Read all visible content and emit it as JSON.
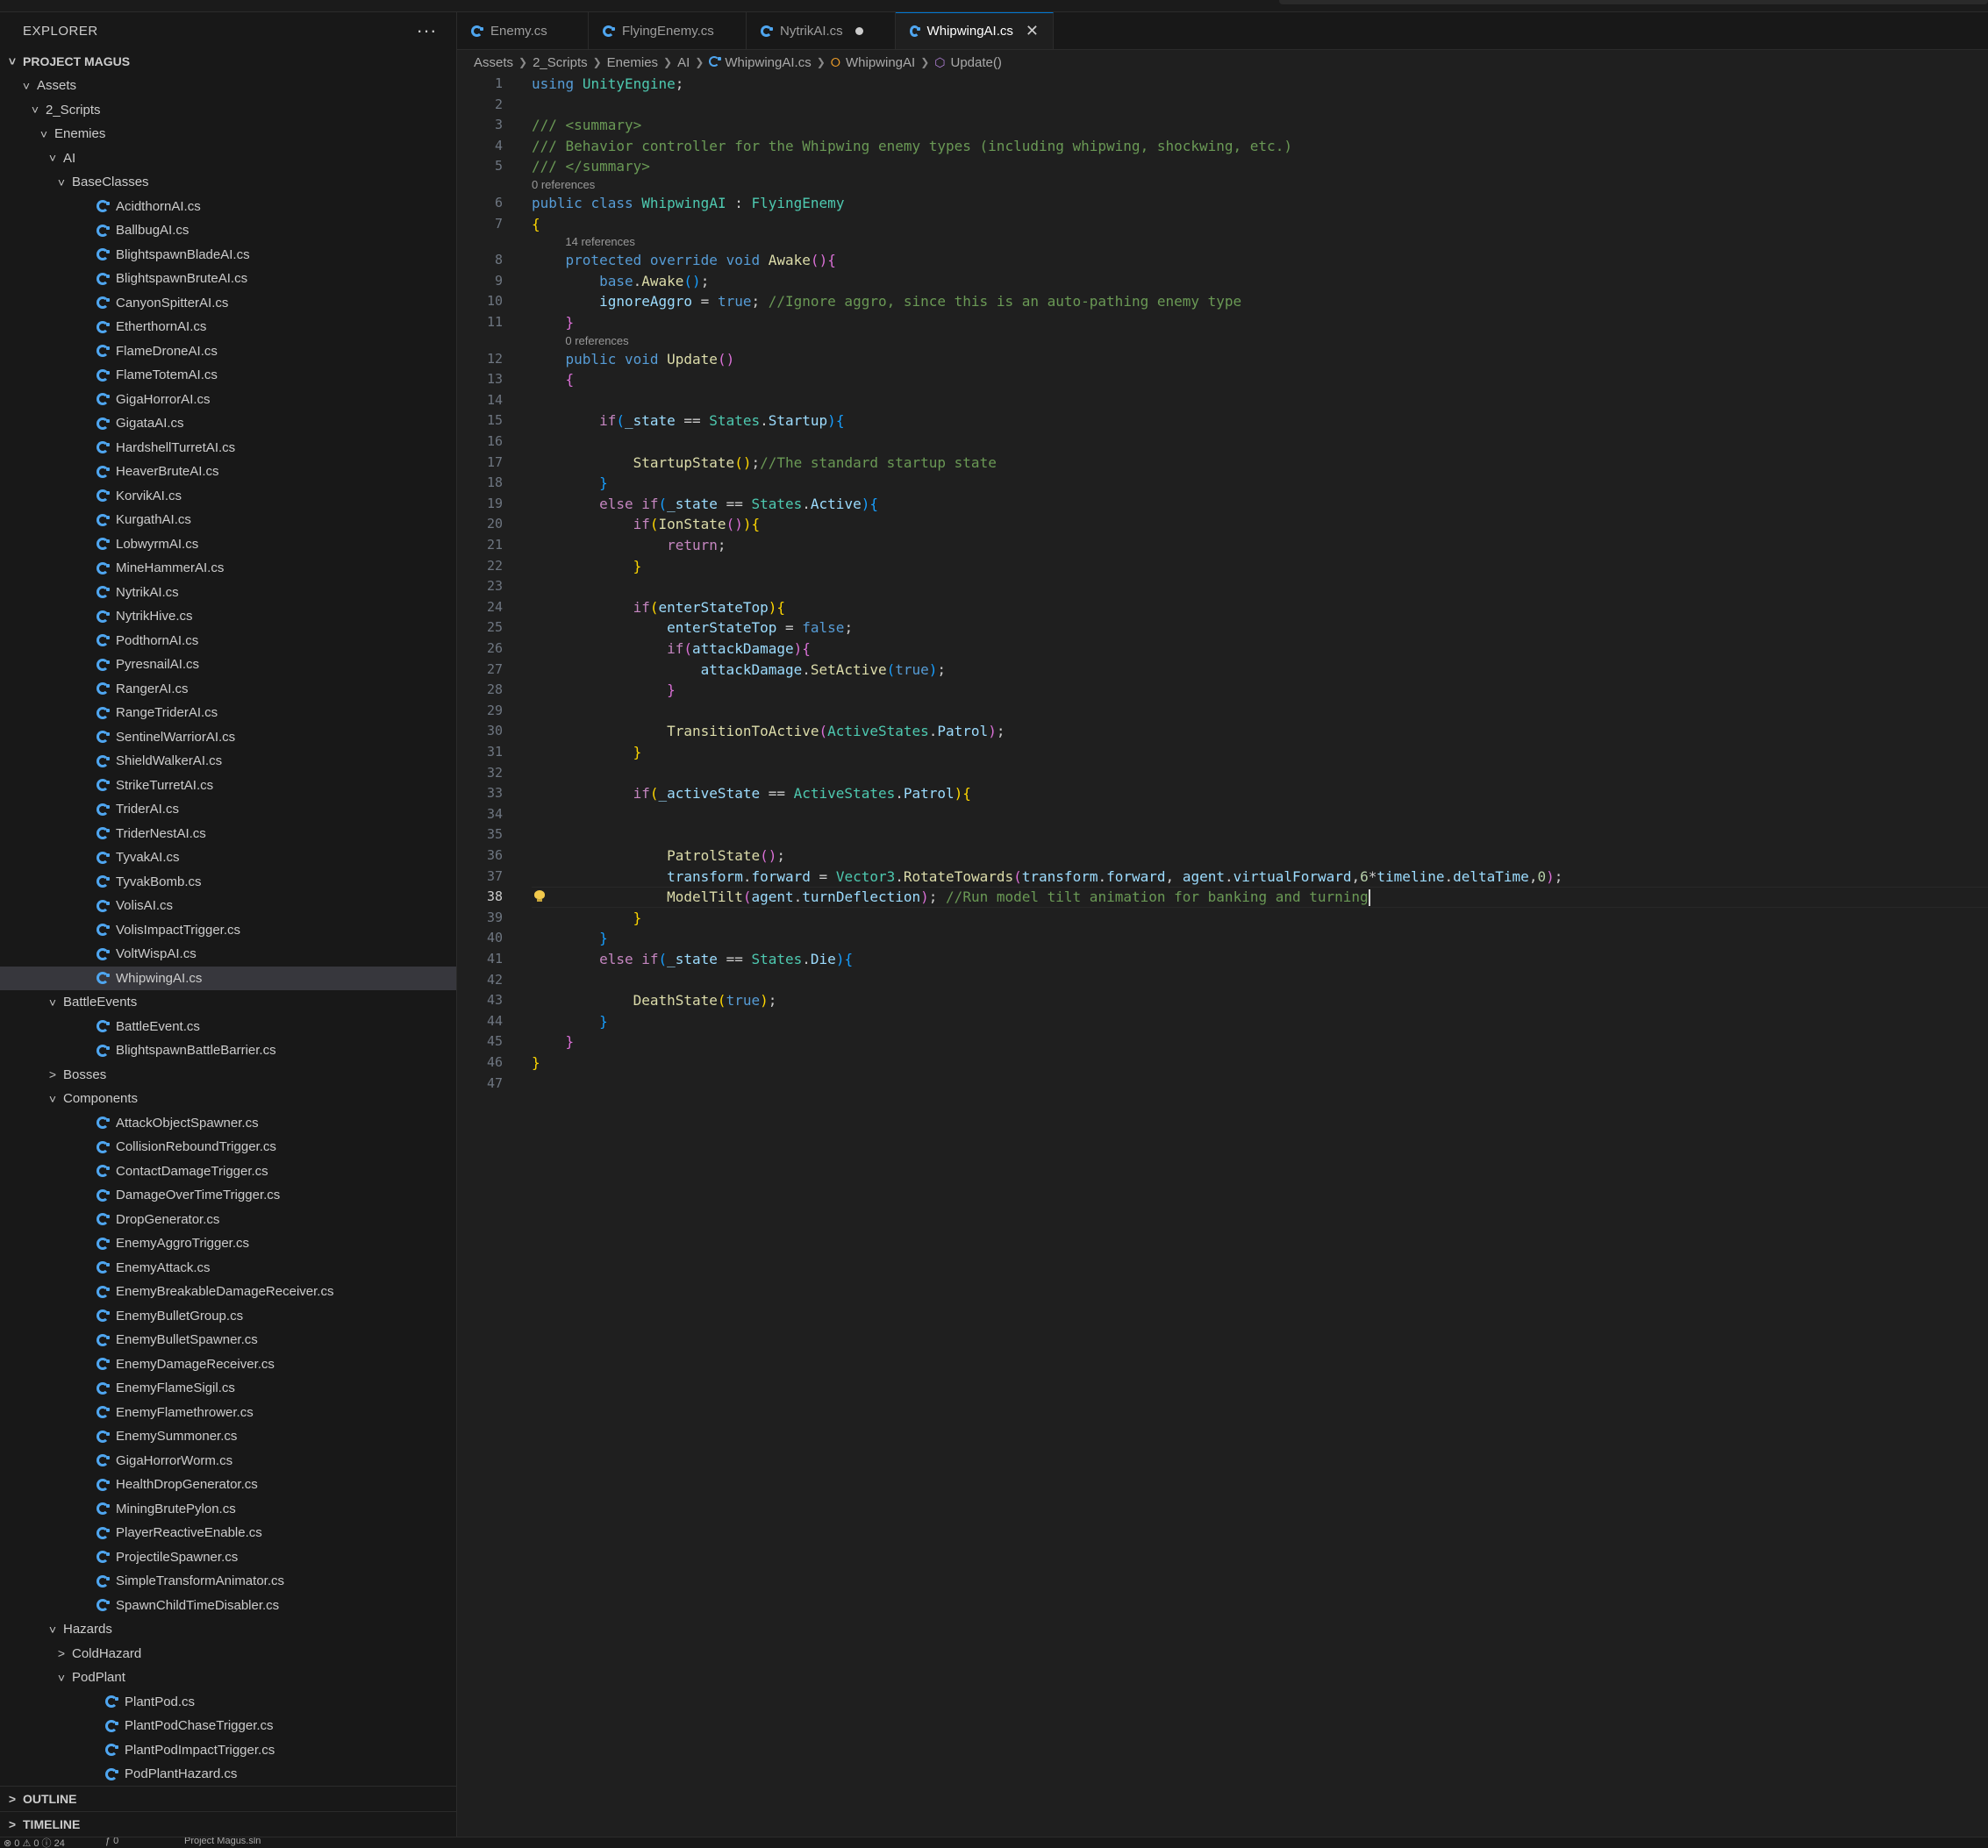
{
  "sidebar": {
    "title": "EXPLORER",
    "more": "···",
    "project": "PROJECT MAGUS",
    "tree": [
      {
        "label": "Assets",
        "depth": 1,
        "type": "folder",
        "open": true
      },
      {
        "label": "2_Scripts",
        "depth": 2,
        "type": "folder",
        "open": true
      },
      {
        "label": "Enemies",
        "depth": 3,
        "type": "folder",
        "open": true
      },
      {
        "label": "AI",
        "depth": 4,
        "type": "folder",
        "open": true
      },
      {
        "label": "BaseClasses",
        "depth": 5,
        "type": "folder",
        "open": true
      },
      {
        "label": "AcidthornAI.cs",
        "depth": 5,
        "type": "file"
      },
      {
        "label": "BallbugAI.cs",
        "depth": 5,
        "type": "file"
      },
      {
        "label": "BlightspawnBladeAI.cs",
        "depth": 5,
        "type": "file"
      },
      {
        "label": "BlightspawnBruteAI.cs",
        "depth": 5,
        "type": "file"
      },
      {
        "label": "CanyonSpitterAI.cs",
        "depth": 5,
        "type": "file"
      },
      {
        "label": "EtherthornAI.cs",
        "depth": 5,
        "type": "file"
      },
      {
        "label": "FlameDroneAI.cs",
        "depth": 5,
        "type": "file"
      },
      {
        "label": "FlameTotemAI.cs",
        "depth": 5,
        "type": "file"
      },
      {
        "label": "GigaHorrorAI.cs",
        "depth": 5,
        "type": "file"
      },
      {
        "label": "GigataAI.cs",
        "depth": 5,
        "type": "file"
      },
      {
        "label": "HardshellTurretAI.cs",
        "depth": 5,
        "type": "file"
      },
      {
        "label": "HeaverBruteAI.cs",
        "depth": 5,
        "type": "file"
      },
      {
        "label": "KorvikAI.cs",
        "depth": 5,
        "type": "file"
      },
      {
        "label": "KurgathAI.cs",
        "depth": 5,
        "type": "file"
      },
      {
        "label": "LobwyrmAI.cs",
        "depth": 5,
        "type": "file"
      },
      {
        "label": "MineHammerAI.cs",
        "depth": 5,
        "type": "file"
      },
      {
        "label": "NytrikAI.cs",
        "depth": 5,
        "type": "file"
      },
      {
        "label": "NytrikHive.cs",
        "depth": 5,
        "type": "file"
      },
      {
        "label": "PodthornAI.cs",
        "depth": 5,
        "type": "file"
      },
      {
        "label": "PyresnailAI.cs",
        "depth": 5,
        "type": "file"
      },
      {
        "label": "RangerAI.cs",
        "depth": 5,
        "type": "file"
      },
      {
        "label": "RangeTriderAI.cs",
        "depth": 5,
        "type": "file"
      },
      {
        "label": "SentinelWarriorAI.cs",
        "depth": 5,
        "type": "file"
      },
      {
        "label": "ShieldWalkerAI.cs",
        "depth": 5,
        "type": "file"
      },
      {
        "label": "StrikeTurretAI.cs",
        "depth": 5,
        "type": "file"
      },
      {
        "label": "TriderAI.cs",
        "depth": 5,
        "type": "file"
      },
      {
        "label": "TriderNestAI.cs",
        "depth": 5,
        "type": "file"
      },
      {
        "label": "TyvakAI.cs",
        "depth": 5,
        "type": "file"
      },
      {
        "label": "TyvakBomb.cs",
        "depth": 5,
        "type": "file"
      },
      {
        "label": "VolisAI.cs",
        "depth": 5,
        "type": "file"
      },
      {
        "label": "VolisImpactTrigger.cs",
        "depth": 5,
        "type": "file"
      },
      {
        "label": "VoltWispAI.cs",
        "depth": 5,
        "type": "file"
      },
      {
        "label": "WhipwingAI.cs",
        "depth": 5,
        "type": "file",
        "selected": true
      },
      {
        "label": "BattleEvents",
        "depth": 4,
        "type": "folder",
        "open": true
      },
      {
        "label": "BattleEvent.cs",
        "depth": 5,
        "type": "file"
      },
      {
        "label": "BlightspawnBattleBarrier.cs",
        "depth": 5,
        "type": "file"
      },
      {
        "label": "Bosses",
        "depth": 4,
        "type": "folder",
        "open": false
      },
      {
        "label": "Components",
        "depth": 4,
        "type": "folder",
        "open": true
      },
      {
        "label": "AttackObjectSpawner.cs",
        "depth": 5,
        "type": "file"
      },
      {
        "label": "CollisionReboundTrigger.cs",
        "depth": 5,
        "type": "file"
      },
      {
        "label": "ContactDamageTrigger.cs",
        "depth": 5,
        "type": "file"
      },
      {
        "label": "DamageOverTimeTrigger.cs",
        "depth": 5,
        "type": "file"
      },
      {
        "label": "DropGenerator.cs",
        "depth": 5,
        "type": "file"
      },
      {
        "label": "EnemyAggroTrigger.cs",
        "depth": 5,
        "type": "file"
      },
      {
        "label": "EnemyAttack.cs",
        "depth": 5,
        "type": "file"
      },
      {
        "label": "EnemyBreakableDamageReceiver.cs",
        "depth": 5,
        "type": "file"
      },
      {
        "label": "EnemyBulletGroup.cs",
        "depth": 5,
        "type": "file"
      },
      {
        "label": "EnemyBulletSpawner.cs",
        "depth": 5,
        "type": "file"
      },
      {
        "label": "EnemyDamageReceiver.cs",
        "depth": 5,
        "type": "file"
      },
      {
        "label": "EnemyFlameSigil.cs",
        "depth": 5,
        "type": "file"
      },
      {
        "label": "EnemyFlamethrower.cs",
        "depth": 5,
        "type": "file"
      },
      {
        "label": "EnemySummoner.cs",
        "depth": 5,
        "type": "file"
      },
      {
        "label": "GigaHorrorWorm.cs",
        "depth": 5,
        "type": "file"
      },
      {
        "label": "HealthDropGenerator.cs",
        "depth": 5,
        "type": "file"
      },
      {
        "label": "MiningBrutePylon.cs",
        "depth": 5,
        "type": "file"
      },
      {
        "label": "PlayerReactiveEnable.cs",
        "depth": 5,
        "type": "file"
      },
      {
        "label": "ProjectileSpawner.cs",
        "depth": 5,
        "type": "file"
      },
      {
        "label": "SimpleTransformAnimator.cs",
        "depth": 5,
        "type": "file"
      },
      {
        "label": "SpawnChildTimeDisabler.cs",
        "depth": 5,
        "type": "file"
      },
      {
        "label": "Hazards",
        "depth": 4,
        "type": "folder",
        "open": true
      },
      {
        "label": "ColdHazard",
        "depth": 5,
        "type": "folder",
        "open": false
      },
      {
        "label": "PodPlant",
        "depth": 5,
        "type": "folder",
        "open": true
      },
      {
        "label": "PlantPod.cs",
        "depth": 6,
        "type": "file"
      },
      {
        "label": "PlantPodChaseTrigger.cs",
        "depth": 6,
        "type": "file"
      },
      {
        "label": "PlantPodImpactTrigger.cs",
        "depth": 6,
        "type": "file"
      },
      {
        "label": "PodPlantHazard.cs",
        "depth": 6,
        "type": "file"
      }
    ],
    "outline": "OUTLINE",
    "timeline": "TIMELINE"
  },
  "tabs": [
    {
      "label": "Enemy.cs",
      "state": "normal"
    },
    {
      "label": "FlyingEnemy.cs",
      "state": "normal"
    },
    {
      "label": "NytrikAI.cs",
      "state": "dirty"
    },
    {
      "label": "WhipwingAI.cs",
      "state": "active"
    }
  ],
  "breadcrumb": {
    "items": [
      "Assets",
      "2_Scripts",
      "Enemies",
      "AI",
      "WhipwingAI.cs",
      "WhipwingAI",
      "Update()"
    ]
  },
  "status": {
    "problems": "⊗ 0 ⚠ 0 ⓘ 24",
    "ports": "ƒ 0",
    "project": "Project Magus.sln"
  },
  "code": {
    "lenses": {
      "l6": "0 references",
      "l8": "14 references",
      "l12": "0 references"
    },
    "lines": [
      "using UnityEngine;",
      "",
      "/// <summary>",
      "/// Behavior controller for the Whipwing enemy types (including whipwing, shockwing, etc.)",
      "/// </summary>",
      "public class WhipwingAI : FlyingEnemy",
      "{",
      "    protected override void Awake(){",
      "        base.Awake();",
      "        ignoreAggro = true; //Ignore aggro, since this is an auto-pathing enemy type",
      "    }",
      "    public void Update()",
      "    {",
      "",
      "        if(_state == States.Startup){",
      "",
      "            StartupState();//The standard startup state",
      "        }",
      "        else if(_state == States.Active){",
      "            if(IonState()){",
      "                return;",
      "            }",
      "",
      "            if(enterStateTop){",
      "                enterStateTop = false;",
      "                if(attackDamage){",
      "                    attackDamage.SetActive(true);",
      "                }",
      "",
      "                TransitionToActive(ActiveStates.Patrol);",
      "            }",
      "",
      "            if(_activeState == ActiveStates.Patrol){",
      "",
      "",
      "                PatrolState();",
      "                transform.forward = Vector3.RotateTowards(transform.forward, agent.virtualForward,6*timeline.deltaTime,0);",
      "                ModelTilt(agent.turnDeflection); //Run model tilt animation for banking and turning",
      "            }",
      "        }",
      "        else if(_state == States.Die){",
      "",
      "            DeathState(true);",
      "        }",
      "    }",
      "}",
      ""
    ]
  },
  "colors": {
    "keyword": "#569cd6",
    "comment": "#6a9955",
    "type": "#4ec9b0",
    "function": "#dcdcaa",
    "variable": "#9cdcfe",
    "number": "#b5cea8",
    "control": "#c586c0",
    "bracket1": "#ffd700",
    "bracket2": "#da70d6",
    "bracket3": "#179fff",
    "accent": "#0078d4"
  }
}
